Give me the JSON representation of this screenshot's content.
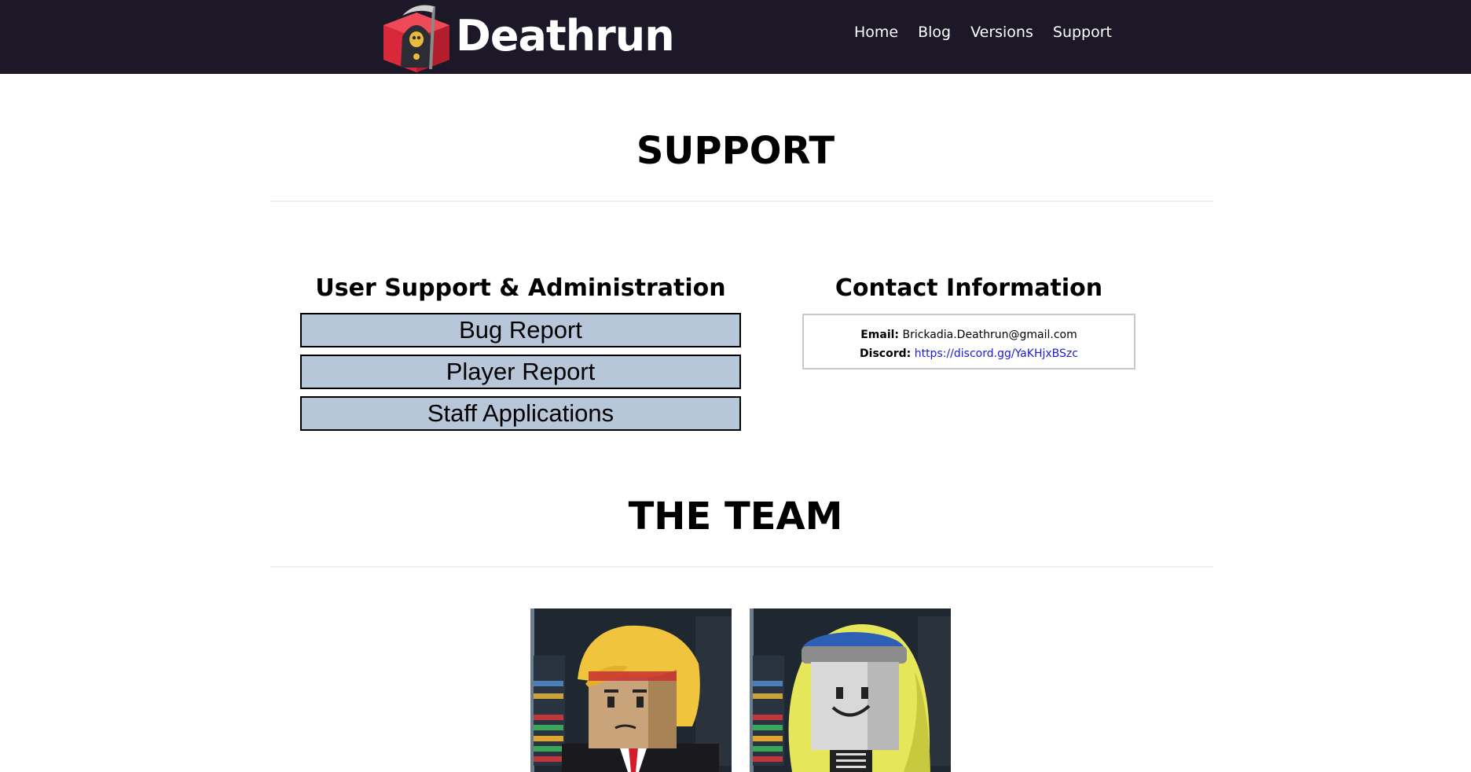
{
  "header": {
    "brand": "Deathrun",
    "nav": [
      {
        "label": "Home"
      },
      {
        "label": "Blog"
      },
      {
        "label": "Versions"
      },
      {
        "label": "Support"
      }
    ]
  },
  "support": {
    "title": "SUPPORT",
    "admin": {
      "heading": "User Support & Administration",
      "buttons": [
        {
          "label": "Bug Report"
        },
        {
          "label": "Player Report"
        },
        {
          "label": "Staff Applications"
        }
      ]
    },
    "contact": {
      "heading": "Contact Information",
      "email_label": "Email:",
      "email_value": "Brickadia.Deathrun@gmail.com",
      "discord_label": "Discord:",
      "discord_value": "https://discord.gg/YaKHjxBSzc"
    }
  },
  "team": {
    "title": "THE TEAM",
    "members": [
      {
        "avatar": "blonde-suit-minifig-avatar"
      },
      {
        "avatar": "yellow-hood-minifig-avatar"
      }
    ]
  },
  "colors": {
    "header_bg": "#1c1828",
    "button_bg": "#b7c6d9",
    "link": "#1b1bd6"
  }
}
